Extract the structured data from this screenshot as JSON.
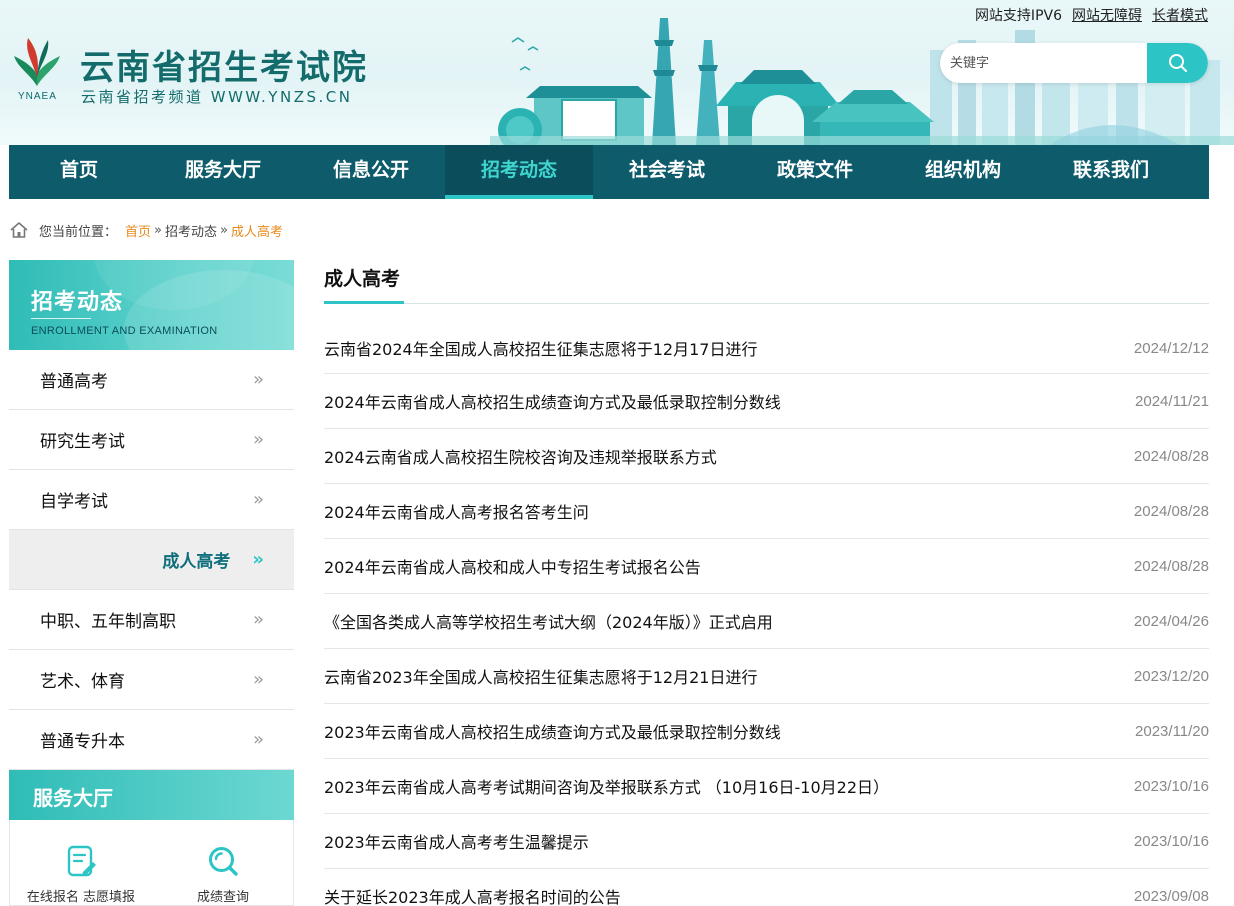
{
  "header": {
    "top_links": [
      "网站支持IPV6",
      "网站无障碍",
      "长者模式"
    ],
    "logo_abbr": "YNAEA",
    "site_title": "云南省招生考试院",
    "site_subtitle": "云南省招考频道 WWW.YNZS.CN",
    "search": {
      "placeholder": "关键字",
      "button_icon": "search-icon"
    }
  },
  "nav": {
    "items": [
      "首页",
      "服务大厅",
      "信息公开",
      "招考动态",
      "社会考试",
      "政策文件",
      "组织机构",
      "联系我们"
    ],
    "active": "招考动态"
  },
  "breadcrumb": {
    "prefix": "您当前位置：",
    "items": [
      "首页",
      "招考动态",
      "成人高考"
    ],
    "separator": "»"
  },
  "sidebar": {
    "title": "招考动态",
    "title_en": "ENROLLMENT AND EXAMINATION",
    "items": [
      "普通高考",
      "研究生考试",
      "自学考试",
      "成人高考",
      "中职、五年制高职",
      "艺术、体育",
      "普通专升本"
    ],
    "active": "成人高考",
    "arrow": "»"
  },
  "service_hall": {
    "title": "服务大厅",
    "tiles": [
      {
        "label": "在线报名 志愿填报",
        "icon": "form-edit-icon"
      },
      {
        "label": "成绩查询",
        "icon": "search-magnifier-icon"
      }
    ]
  },
  "main": {
    "title": "成人高考",
    "news": [
      {
        "title": "云南省2024年全国成人高校招生征集志愿将于12月17日进行",
        "date": "2024/12/12"
      },
      {
        "title": "2024年云南省成人高校招生成绩查询方式及最低录取控制分数线",
        "date": "2024/11/21"
      },
      {
        "title": "2024云南省成人高校招生院校咨询及违规举报联系方式",
        "date": "2024/08/28"
      },
      {
        "title": "2024年云南省成人高考报名答考生问",
        "date": "2024/08/28"
      },
      {
        "title": "2024年云南省成人高校和成人中专招生考试报名公告",
        "date": "2024/08/28"
      },
      {
        "title": "《全国各类成人高等学校招生考试大纲（2024年版）》正式启用",
        "date": "2024/04/26"
      },
      {
        "title": "云南省2023年全国成人高校招生征集志愿将于12月21日进行",
        "date": "2023/12/20"
      },
      {
        "title": "2023年云南省成人高校招生成绩查询方式及最低录取控制分数线",
        "date": "2023/11/20"
      },
      {
        "title": "2023年云南省成人高考考试期间咨询及举报联系方式 （10月16日-10月22日）",
        "date": "2023/10/16"
      },
      {
        "title": "2023年云南省成人高考考生温馨提示",
        "date": "2023/10/16"
      },
      {
        "title": "关于延长2023年成人高考报名时间的公告",
        "date": "2023/09/08"
      }
    ]
  },
  "colors": {
    "nav_bg": "#0e5b6b",
    "accent": "#2cc4c4",
    "breadcrumb_link": "#e78a1f",
    "title_green": "#146b6b"
  }
}
